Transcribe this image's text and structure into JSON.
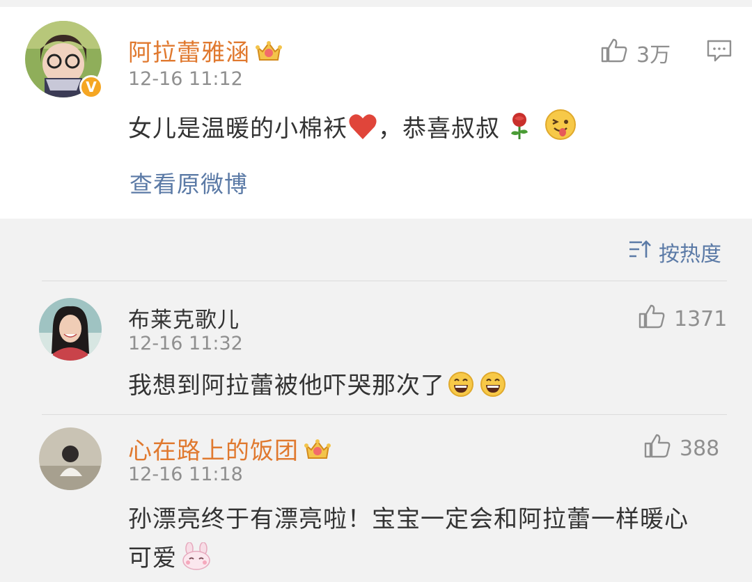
{
  "main_post": {
    "username": "阿拉蕾雅涵",
    "time": "12-16 11:12",
    "likes": "3万",
    "text_part1": "女儿是温暖的小棉袄",
    "text_part2": "，恭喜叔叔",
    "view_original": "查看原微博",
    "badge": "V"
  },
  "sort": {
    "label": "按热度"
  },
  "comments": [
    {
      "username": "布莱克歌儿",
      "time": "12-16 11:32",
      "likes": "1371",
      "text": "我想到阿拉蕾被他吓哭那次了"
    },
    {
      "username": "心在路上的饭团",
      "time": "12-16 11:18",
      "likes": "388",
      "text_line1": "孙漂亮终于有漂亮啦！宝宝一定会和阿拉蕾一样暖心",
      "text_line2": "可爱"
    }
  ],
  "colors": {
    "vip_name": "#e0792f",
    "link": "#5b7aa6",
    "meta": "#8f8f8f"
  },
  "icons": [
    "thumb-up-icon",
    "comment-icon",
    "crown-icon",
    "heart-emoji-icon",
    "rose-emoji-icon",
    "tongue-emoji-icon",
    "laugh-emoji-icon",
    "bunny-emoji-icon",
    "sort-icon"
  ]
}
